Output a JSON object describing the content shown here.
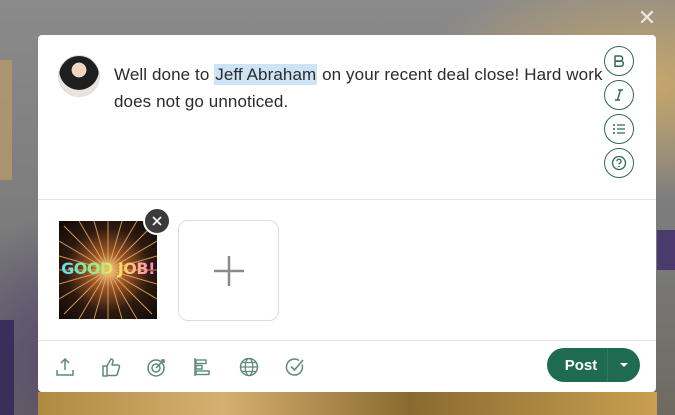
{
  "composer": {
    "message_before": "Well done to ",
    "mention": "Jeff Abraham",
    "message_after": " on your recent deal close! Hard work does not go unnoticed.",
    "format_buttons": [
      "bold-icon",
      "italic-icon",
      "list-icon",
      "help-icon"
    ]
  },
  "attachment": {
    "gif_text": "GOOD JOB!",
    "remove_icon": "close-icon",
    "add_icon": "plus-icon"
  },
  "toolbar": {
    "icons": [
      "upload-icon",
      "thumbs-up-icon",
      "target-icon",
      "align-chart-icon",
      "globe-icon",
      "check-circle-icon"
    ],
    "post_label": "Post",
    "caret_icon": "chevron-down-icon"
  },
  "colors": {
    "accent": "#1e6b51",
    "mention_highlight": "#cfe3f7"
  }
}
